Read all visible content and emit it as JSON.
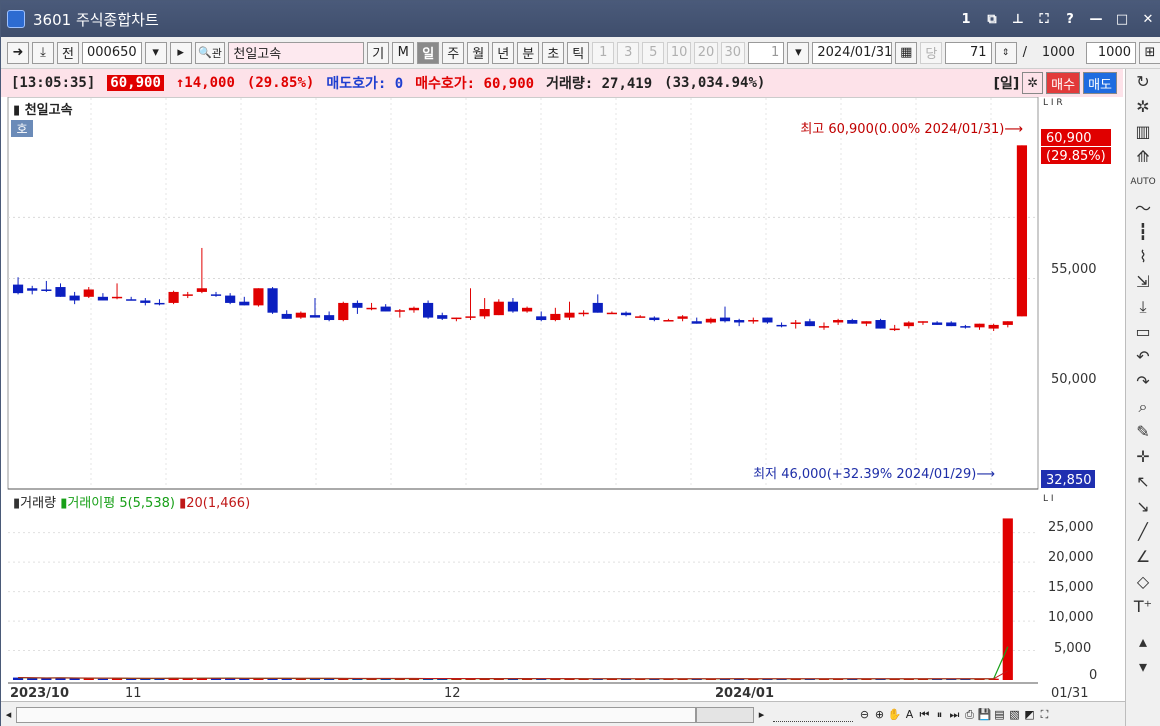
{
  "window": {
    "title": "3601 주식종합차트"
  },
  "toolbar": {
    "prev_label": "전",
    "code": "000650",
    "name": "천일고속",
    "search_icon": "🔍",
    "gwan_label": "관",
    "gi_label": "기",
    "m_label": "M",
    "periods": [
      "일",
      "주",
      "월",
      "년",
      "분",
      "초",
      "틱"
    ],
    "active_period": "일",
    "minute_options": [
      "1",
      "3",
      "5",
      "10",
      "20",
      "30"
    ],
    "unit_value": "1",
    "date": "2024/01/31",
    "dang_label": "당",
    "count": "71",
    "total": "1000",
    "view_count": "1000"
  },
  "status": {
    "time": "[13:05:35]",
    "price": "60,900",
    "change": "↑14,000",
    "change_rate": "(29.85%)",
    "ask_label": "매도호가: 0",
    "bid_label": "매수호가: 60,900",
    "volume_label": "거래량: 27,419",
    "volume_rate": "(33,034.94%)",
    "period_tag": "[일]",
    "sell_label": "매수",
    "buy_label": "매도"
  },
  "price_panel": {
    "name": "천일고속",
    "mode_badge": "호",
    "high_annotation": "최고 60,900(0.00% 2024/01/31)⟶",
    "low_annotation": "최저 46,000(+32.39% 2024/01/29)⟶",
    "last_price": "60,900",
    "last_change": "(29.85%)",
    "bottom_label": "32,850",
    "y_ticks": [
      "55,000",
      "50,000"
    ],
    "lir": "L I R"
  },
  "volume_panel": {
    "legend": [
      "거래량",
      "거래이평 5(5,538)",
      "20(1,466)"
    ],
    "y_ticks": [
      "25,000",
      "20,000",
      "15,000",
      "10,000",
      "5,000",
      "0"
    ],
    "li": "L I"
  },
  "x_axis": {
    "labels": [
      "2023/10",
      "11",
      "12",
      "2024/01"
    ],
    "last_date": "01/31"
  },
  "colors": {
    "up": "#e00000",
    "down": "#0b1fc0",
    "ma5": "#18a018",
    "ma20": "#c01818"
  },
  "chart_data": {
    "type": "candlestick",
    "price_ylim": [
      32850,
      61500
    ],
    "volume_ylim": [
      0,
      28000
    ],
    "candles": [
      [
        49500,
        50100,
        48700,
        48800
      ],
      [
        49200,
        49400,
        48700,
        49000
      ],
      [
        49100,
        49800,
        48900,
        49000
      ],
      [
        49300,
        49600,
        48500,
        48500
      ],
      [
        48600,
        48900,
        47900,
        48200
      ],
      [
        48500,
        49300,
        48400,
        49100
      ],
      [
        48500,
        48800,
        48200,
        48200
      ],
      [
        48400,
        49600,
        48300,
        48500
      ],
      [
        48300,
        48500,
        48200,
        48200
      ],
      [
        48200,
        48400,
        47800,
        48000
      ],
      [
        48000,
        48300,
        47800,
        47900
      ],
      [
        48000,
        49000,
        47900,
        48900
      ],
      [
        48600,
        48900,
        48400,
        48700
      ],
      [
        48900,
        52500,
        48800,
        49200
      ],
      [
        48700,
        48900,
        48500,
        48600
      ],
      [
        48600,
        48800,
        47900,
        48000
      ],
      [
        48100,
        48500,
        47800,
        47800
      ],
      [
        47800,
        49200,
        47700,
        49200
      ],
      [
        49200,
        49300,
        47100,
        47200
      ],
      [
        47100,
        47400,
        46700,
        46700
      ],
      [
        46800,
        47300,
        46700,
        47200
      ],
      [
        47000,
        48400,
        46800,
        46800
      ],
      [
        47000,
        47300,
        46500,
        46600
      ],
      [
        46600,
        48100,
        46500,
        48000
      ],
      [
        48000,
        48200,
        47100,
        47600
      ],
      [
        47600,
        48000,
        47400,
        47600
      ],
      [
        47700,
        47900,
        47300,
        47300
      ],
      [
        47300,
        47500,
        46800,
        47400
      ],
      [
        47400,
        47700,
        47200,
        47600
      ],
      [
        48000,
        48200,
        46700,
        46800
      ],
      [
        47000,
        47200,
        46600,
        46700
      ],
      [
        46700,
        46800,
        46500,
        46800
      ],
      [
        46900,
        49200,
        46600,
        46900
      ],
      [
        46900,
        48400,
        46700,
        47500
      ],
      [
        47000,
        48300,
        47000,
        48100
      ],
      [
        48100,
        48400,
        47200,
        47300
      ],
      [
        47300,
        47700,
        47200,
        47600
      ],
      [
        46900,
        47300,
        46500,
        46600
      ],
      [
        46600,
        47600,
        46500,
        47100
      ],
      [
        46800,
        48100,
        46600,
        47200
      ],
      [
        47200,
        47400,
        46900,
        47200
      ],
      [
        48000,
        48700,
        47200,
        47200
      ],
      [
        47200,
        47300,
        47100,
        47200
      ],
      [
        47200,
        47300,
        46900,
        47000
      ],
      [
        46900,
        47000,
        46800,
        46900
      ],
      [
        46800,
        46900,
        46500,
        46600
      ],
      [
        46600,
        46700,
        46500,
        46600
      ],
      [
        46700,
        47000,
        46500,
        46900
      ],
      [
        46500,
        46800,
        46300,
        46300
      ],
      [
        46400,
        46800,
        46300,
        46700
      ],
      [
        46800,
        47700,
        46400,
        46500
      ],
      [
        46600,
        46700,
        46100,
        46400
      ],
      [
        46600,
        46800,
        46300,
        46600
      ],
      [
        46800,
        46800,
        46300,
        46400
      ],
      [
        46200,
        46400,
        46000,
        46100
      ],
      [
        46400,
        46600,
        45900,
        46400
      ],
      [
        46500,
        46700,
        46100,
        46100
      ],
      [
        46100,
        46400,
        45800,
        46100
      ],
      [
        46400,
        46700,
        46200,
        46600
      ],
      [
        46600,
        46700,
        46300,
        46300
      ],
      [
        46300,
        46500,
        46100,
        46500
      ],
      [
        46600,
        46700,
        45900,
        45900
      ],
      [
        45900,
        46200,
        45700,
        45900
      ],
      [
        46100,
        46500,
        45900,
        46400
      ],
      [
        46400,
        46500,
        46200,
        46500
      ],
      [
        46400,
        46500,
        46200,
        46200
      ],
      [
        46400,
        46500,
        46100,
        46100
      ],
      [
        46100,
        46200,
        45900,
        46000
      ],
      [
        46000,
        46300,
        45800,
        46300
      ],
      [
        45900,
        46300,
        45700,
        46200
      ],
      [
        46200,
        46500,
        46000,
        46500
      ],
      [
        46900,
        60900,
        46900,
        60900
      ]
    ],
    "volumes": [
      410,
      320,
      300,
      380,
      310,
      280,
      220,
      300,
      260,
      250,
      270,
      380,
      320,
      300,
      280,
      300,
      260,
      240,
      280,
      260,
      250,
      240,
      260,
      230,
      250,
      240,
      230,
      220,
      210,
      230,
      220,
      200,
      260,
      240,
      230,
      220,
      210,
      200,
      230,
      220,
      210,
      200,
      210,
      190,
      200,
      210,
      200,
      230,
      210,
      200,
      220,
      210,
      200,
      190,
      200,
      210,
      200,
      190,
      200,
      210,
      190,
      200,
      190,
      200,
      210,
      200,
      190,
      200,
      210,
      230,
      27419
    ]
  }
}
